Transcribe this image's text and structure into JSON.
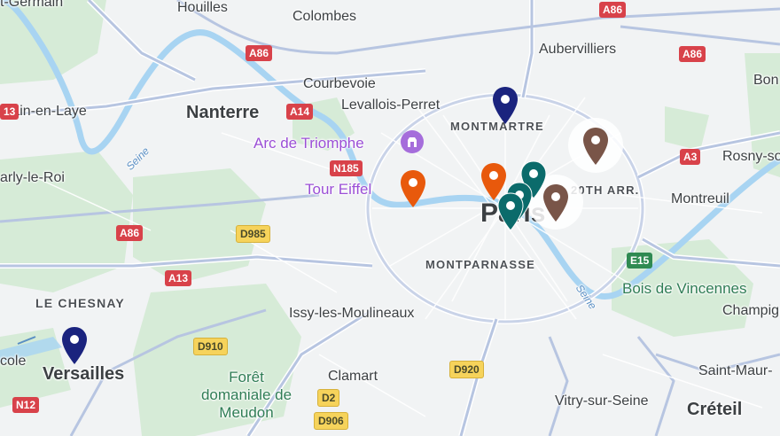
{
  "map": {
    "places": {
      "houilles": "Houilles",
      "colombes": "Colombes",
      "aubervilliers": "Aubervilliers",
      "nanterre": "Nanterre",
      "courbevoie": "Courbevoie",
      "levallois": "Levallois-Perret",
      "montmartre": "MONTMARTRE",
      "st_germain": "main-en-Laye",
      "marly": "arly-le-Roi",
      "rosny": "Rosny-so",
      "montreuil": "Montreuil",
      "twentieth": "20TH ARR.",
      "paris": "Paris",
      "montparnasse": "MONTPARNASSE",
      "le_chesnay": "LE CHESNAY",
      "versailles": "Versailles",
      "issy": "Issy-les-Moulineaux",
      "clamart": "Clamart",
      "vitry": "Vitry-sur-Seine",
      "saint_maur": "Saint-Maur-",
      "creteil": "Créteil",
      "champigny": "Champig",
      "ecole": "cole",
      "bon": "Bon",
      "germain_top": "t-Germain"
    },
    "pois": {
      "arc": "Arc de Triomphe",
      "eiffel": "Tour Eiffel"
    },
    "parks": {
      "vincennes": "Bois de Vincennes",
      "meudon": "Forêt domaniale de Meudon"
    },
    "rivers": {
      "seine_west": "Seine",
      "seine_east": "Seine"
    },
    "roads": {
      "a86_top": "A86",
      "a86_left": "A86",
      "a86_right": "A86",
      "a86_top2": "A86",
      "a14": "A14",
      "n185": "N185",
      "d985": "D985",
      "a13": "A13",
      "a3": "A3",
      "e15": "E15",
      "d910": "D910",
      "d920": "D920",
      "d2": "D2",
      "d906": "D906",
      "n12": "N12",
      "n13": "13"
    },
    "colors": {
      "pin_navy": "#1a237e",
      "pin_orange": "#e8590c",
      "pin_teal": "#0b6b6b",
      "pin_brown": "#795548",
      "poi_purple": "#9b4fd6",
      "park_green": "#cfe8d3",
      "water": "#a8d4f2"
    }
  }
}
